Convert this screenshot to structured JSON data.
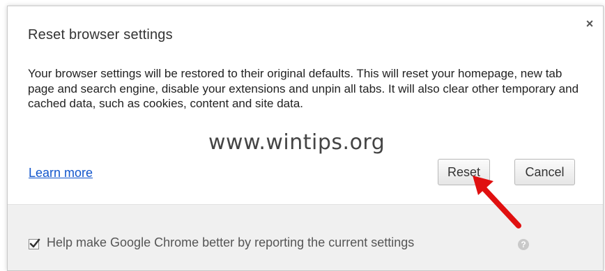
{
  "dialog": {
    "title": "Reset browser settings",
    "close_glyph": "×",
    "description": "Your browser settings will be restored to their original defaults. This will reset your homepage, new tab page and search engine, disable your extensions and unpin all tabs. It will also clear other temporary and cached data, such as cookies, content and site data.",
    "learn_more_label": "Learn more",
    "reset_label": "Reset",
    "cancel_label": "Cancel"
  },
  "footer": {
    "checkbox_checked": true,
    "checkbox_label": "Help make Google Chrome better by reporting the current settings",
    "help_glyph": "?"
  },
  "overlay": {
    "watermark": "www.wintips.org",
    "arrow_color": "#e01010",
    "arrow_target": "reset-button"
  },
  "colors": {
    "link": "#1155cc",
    "footer_bg": "#f0f0f0",
    "button_border": "#b8b8b8"
  }
}
